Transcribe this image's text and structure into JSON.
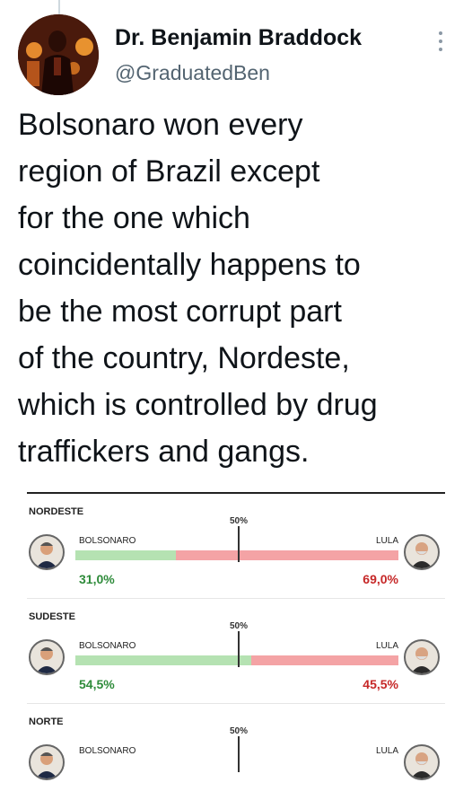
{
  "tweet": {
    "author_name": "Dr. Benjamin Braddock",
    "handle": "@GraduatedBen",
    "text_lines": [
      "Bolsonaro won every",
      "region of Brazil except",
      "for the one which",
      "coincidentally happens to",
      "be the most corrupt part",
      "of the country, Nordeste,",
      "which is controlled by drug",
      "traffickers and gangs."
    ],
    "icons": {
      "more": "more-vertical-icon",
      "avatar": "avatar-image"
    }
  },
  "results": {
    "midpoint_label": "50%",
    "regions": [
      {
        "name": "NORDESTE",
        "left_candidate": "BOLSONARO",
        "right_candidate": "LULA",
        "left_pct_text": "31,0%",
        "right_pct_text": "69,0%",
        "left_share": 0.31
      },
      {
        "name": "SUDESTE",
        "left_candidate": "BOLSONARO",
        "right_candidate": "LULA",
        "left_pct_text": "54,5%",
        "right_pct_text": "45,5%",
        "left_share": 0.545
      },
      {
        "name": "NORTE",
        "left_candidate": "BOLSONARO",
        "right_candidate": "LULA",
        "left_pct_text": "",
        "right_pct_text": "",
        "left_share": 0.5
      }
    ],
    "colors": {
      "left": "#b5e2b2",
      "right": "#f4a3a5",
      "left_text": "#2e8b3a",
      "right_text": "#c62828"
    }
  }
}
